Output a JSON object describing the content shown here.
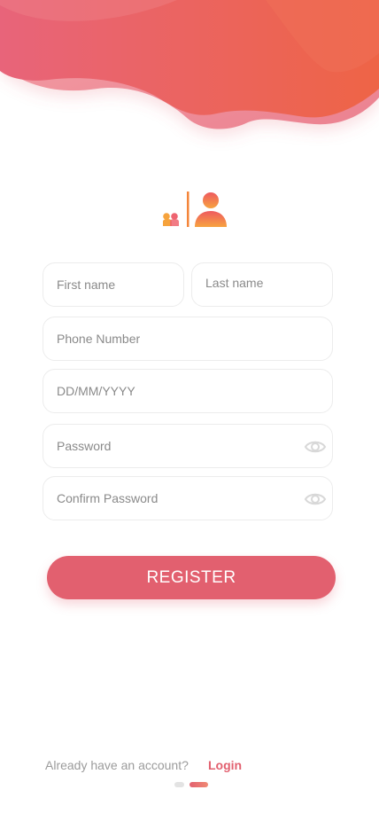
{
  "form": {
    "first_name_placeholder": "First name",
    "last_name_placeholder": "Last name",
    "phone_placeholder": "Phone Number",
    "dob_placeholder": "DD/MM/YYYY",
    "password_placeholder": "Password",
    "confirm_password_placeholder": "Confirm Password"
  },
  "actions": {
    "register_label": "REGISTER"
  },
  "footer": {
    "prompt": "Already have an account?",
    "login_label": "Login"
  },
  "icons": {
    "header": "wave-background",
    "logo": "users-logo-icon",
    "password_toggle": "eye-icon"
  },
  "pager": {
    "active_index": 2,
    "total": 2
  },
  "colors": {
    "accent": "#e2606f",
    "accent_light": "#f08a74",
    "orange": "#f5a53a",
    "field_border": "#ececec",
    "placeholder": "#8a8a8a"
  }
}
